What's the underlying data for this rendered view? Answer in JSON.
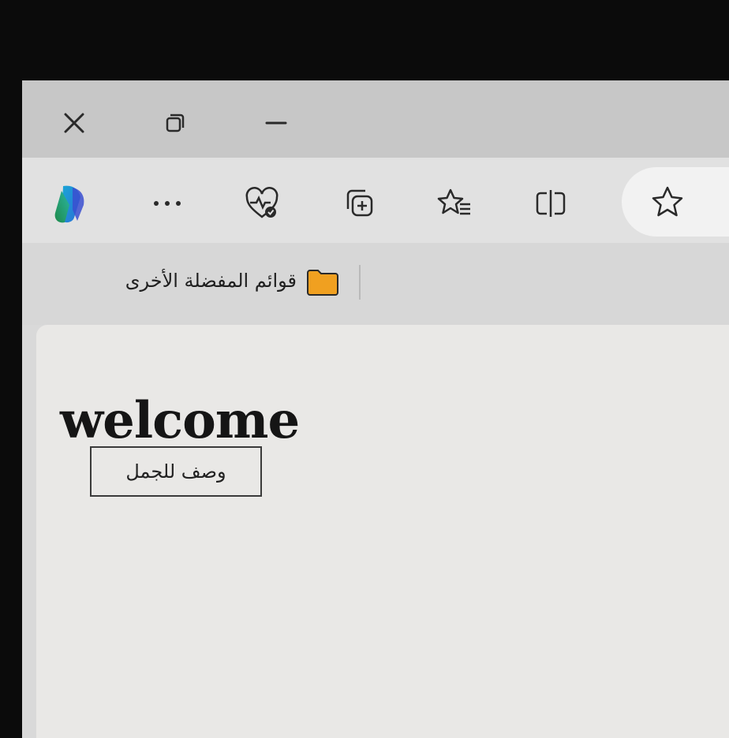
{
  "window_controls": {
    "close_icon": "close-icon",
    "restore_icon": "restore-icon",
    "minimize_icon": "minimize-icon"
  },
  "toolbar": {
    "icons": [
      "copilot-icon",
      "more-icon",
      "browser-essentials-icon",
      "collections-icon",
      "favorites-icon",
      "split-screen-icon",
      "favorite-star-icon"
    ]
  },
  "favorites_bar": {
    "other_favorites_label": "قوائم المفضلة الأخرى",
    "folder_color": "#f0a020"
  },
  "page": {
    "heading": "welcome",
    "button_label": "وصف للجمل"
  }
}
